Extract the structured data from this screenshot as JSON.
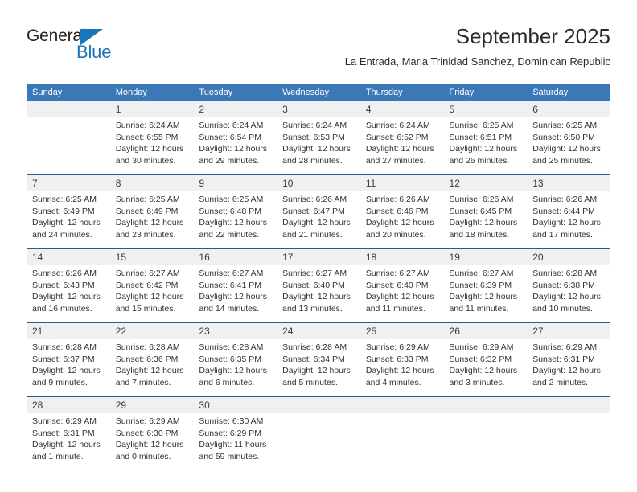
{
  "logo": {
    "word_top": "General",
    "word_bottom": "Blue",
    "triangle_color": "#1b75bb"
  },
  "header": {
    "title": "September 2025",
    "subtitle": "La Entrada, Maria Trinidad Sanchez, Dominican Republic"
  },
  "colors": {
    "header_blue": "#3b78b8",
    "rule_blue": "#1b5fa0",
    "daynum_band": "#f0f0f0",
    "brand_blue": "#1b75bb"
  },
  "calendar": {
    "weekday_headers": [
      "Sunday",
      "Monday",
      "Tuesday",
      "Wednesday",
      "Thursday",
      "Friday",
      "Saturday"
    ],
    "weeks": [
      [
        {
          "day": "",
          "sunrise": "",
          "sunset": "",
          "daylight_1": "",
          "daylight_2": ""
        },
        {
          "day": "1",
          "sunrise": "Sunrise: 6:24 AM",
          "sunset": "Sunset: 6:55 PM",
          "daylight_1": "Daylight: 12 hours",
          "daylight_2": "and 30 minutes."
        },
        {
          "day": "2",
          "sunrise": "Sunrise: 6:24 AM",
          "sunset": "Sunset: 6:54 PM",
          "daylight_1": "Daylight: 12 hours",
          "daylight_2": "and 29 minutes."
        },
        {
          "day": "3",
          "sunrise": "Sunrise: 6:24 AM",
          "sunset": "Sunset: 6:53 PM",
          "daylight_1": "Daylight: 12 hours",
          "daylight_2": "and 28 minutes."
        },
        {
          "day": "4",
          "sunrise": "Sunrise: 6:24 AM",
          "sunset": "Sunset: 6:52 PM",
          "daylight_1": "Daylight: 12 hours",
          "daylight_2": "and 27 minutes."
        },
        {
          "day": "5",
          "sunrise": "Sunrise: 6:25 AM",
          "sunset": "Sunset: 6:51 PM",
          "daylight_1": "Daylight: 12 hours",
          "daylight_2": "and 26 minutes."
        },
        {
          "day": "6",
          "sunrise": "Sunrise: 6:25 AM",
          "sunset": "Sunset: 6:50 PM",
          "daylight_1": "Daylight: 12 hours",
          "daylight_2": "and 25 minutes."
        }
      ],
      [
        {
          "day": "7",
          "sunrise": "Sunrise: 6:25 AM",
          "sunset": "Sunset: 6:49 PM",
          "daylight_1": "Daylight: 12 hours",
          "daylight_2": "and 24 minutes."
        },
        {
          "day": "8",
          "sunrise": "Sunrise: 6:25 AM",
          "sunset": "Sunset: 6:49 PM",
          "daylight_1": "Daylight: 12 hours",
          "daylight_2": "and 23 minutes."
        },
        {
          "day": "9",
          "sunrise": "Sunrise: 6:25 AM",
          "sunset": "Sunset: 6:48 PM",
          "daylight_1": "Daylight: 12 hours",
          "daylight_2": "and 22 minutes."
        },
        {
          "day": "10",
          "sunrise": "Sunrise: 6:26 AM",
          "sunset": "Sunset: 6:47 PM",
          "daylight_1": "Daylight: 12 hours",
          "daylight_2": "and 21 minutes."
        },
        {
          "day": "11",
          "sunrise": "Sunrise: 6:26 AM",
          "sunset": "Sunset: 6:46 PM",
          "daylight_1": "Daylight: 12 hours",
          "daylight_2": "and 20 minutes."
        },
        {
          "day": "12",
          "sunrise": "Sunrise: 6:26 AM",
          "sunset": "Sunset: 6:45 PM",
          "daylight_1": "Daylight: 12 hours",
          "daylight_2": "and 18 minutes."
        },
        {
          "day": "13",
          "sunrise": "Sunrise: 6:26 AM",
          "sunset": "Sunset: 6:44 PM",
          "daylight_1": "Daylight: 12 hours",
          "daylight_2": "and 17 minutes."
        }
      ],
      [
        {
          "day": "14",
          "sunrise": "Sunrise: 6:26 AM",
          "sunset": "Sunset: 6:43 PM",
          "daylight_1": "Daylight: 12 hours",
          "daylight_2": "and 16 minutes."
        },
        {
          "day": "15",
          "sunrise": "Sunrise: 6:27 AM",
          "sunset": "Sunset: 6:42 PM",
          "daylight_1": "Daylight: 12 hours",
          "daylight_2": "and 15 minutes."
        },
        {
          "day": "16",
          "sunrise": "Sunrise: 6:27 AM",
          "sunset": "Sunset: 6:41 PM",
          "daylight_1": "Daylight: 12 hours",
          "daylight_2": "and 14 minutes."
        },
        {
          "day": "17",
          "sunrise": "Sunrise: 6:27 AM",
          "sunset": "Sunset: 6:40 PM",
          "daylight_1": "Daylight: 12 hours",
          "daylight_2": "and 13 minutes."
        },
        {
          "day": "18",
          "sunrise": "Sunrise: 6:27 AM",
          "sunset": "Sunset: 6:40 PM",
          "daylight_1": "Daylight: 12 hours",
          "daylight_2": "and 11 minutes."
        },
        {
          "day": "19",
          "sunrise": "Sunrise: 6:27 AM",
          "sunset": "Sunset: 6:39 PM",
          "daylight_1": "Daylight: 12 hours",
          "daylight_2": "and 11 minutes."
        },
        {
          "day": "20",
          "sunrise": "Sunrise: 6:28 AM",
          "sunset": "Sunset: 6:38 PM",
          "daylight_1": "Daylight: 12 hours",
          "daylight_2": "and 10 minutes."
        }
      ],
      [
        {
          "day": "21",
          "sunrise": "Sunrise: 6:28 AM",
          "sunset": "Sunset: 6:37 PM",
          "daylight_1": "Daylight: 12 hours",
          "daylight_2": "and 9 minutes."
        },
        {
          "day": "22",
          "sunrise": "Sunrise: 6:28 AM",
          "sunset": "Sunset: 6:36 PM",
          "daylight_1": "Daylight: 12 hours",
          "daylight_2": "and 7 minutes."
        },
        {
          "day": "23",
          "sunrise": "Sunrise: 6:28 AM",
          "sunset": "Sunset: 6:35 PM",
          "daylight_1": "Daylight: 12 hours",
          "daylight_2": "and 6 minutes."
        },
        {
          "day": "24",
          "sunrise": "Sunrise: 6:28 AM",
          "sunset": "Sunset: 6:34 PM",
          "daylight_1": "Daylight: 12 hours",
          "daylight_2": "and 5 minutes."
        },
        {
          "day": "25",
          "sunrise": "Sunrise: 6:29 AM",
          "sunset": "Sunset: 6:33 PM",
          "daylight_1": "Daylight: 12 hours",
          "daylight_2": "and 4 minutes."
        },
        {
          "day": "26",
          "sunrise": "Sunrise: 6:29 AM",
          "sunset": "Sunset: 6:32 PM",
          "daylight_1": "Daylight: 12 hours",
          "daylight_2": "and 3 minutes."
        },
        {
          "day": "27",
          "sunrise": "Sunrise: 6:29 AM",
          "sunset": "Sunset: 6:31 PM",
          "daylight_1": "Daylight: 12 hours",
          "daylight_2": "and 2 minutes."
        }
      ],
      [
        {
          "day": "28",
          "sunrise": "Sunrise: 6:29 AM",
          "sunset": "Sunset: 6:31 PM",
          "daylight_1": "Daylight: 12 hours",
          "daylight_2": "and 1 minute."
        },
        {
          "day": "29",
          "sunrise": "Sunrise: 6:29 AM",
          "sunset": "Sunset: 6:30 PM",
          "daylight_1": "Daylight: 12 hours",
          "daylight_2": "and 0 minutes."
        },
        {
          "day": "30",
          "sunrise": "Sunrise: 6:30 AM",
          "sunset": "Sunset: 6:29 PM",
          "daylight_1": "Daylight: 11 hours",
          "daylight_2": "and 59 minutes."
        },
        {
          "day": "",
          "sunrise": "",
          "sunset": "",
          "daylight_1": "",
          "daylight_2": ""
        },
        {
          "day": "",
          "sunrise": "",
          "sunset": "",
          "daylight_1": "",
          "daylight_2": ""
        },
        {
          "day": "",
          "sunrise": "",
          "sunset": "",
          "daylight_1": "",
          "daylight_2": ""
        },
        {
          "day": "",
          "sunrise": "",
          "sunset": "",
          "daylight_1": "",
          "daylight_2": ""
        }
      ]
    ]
  }
}
